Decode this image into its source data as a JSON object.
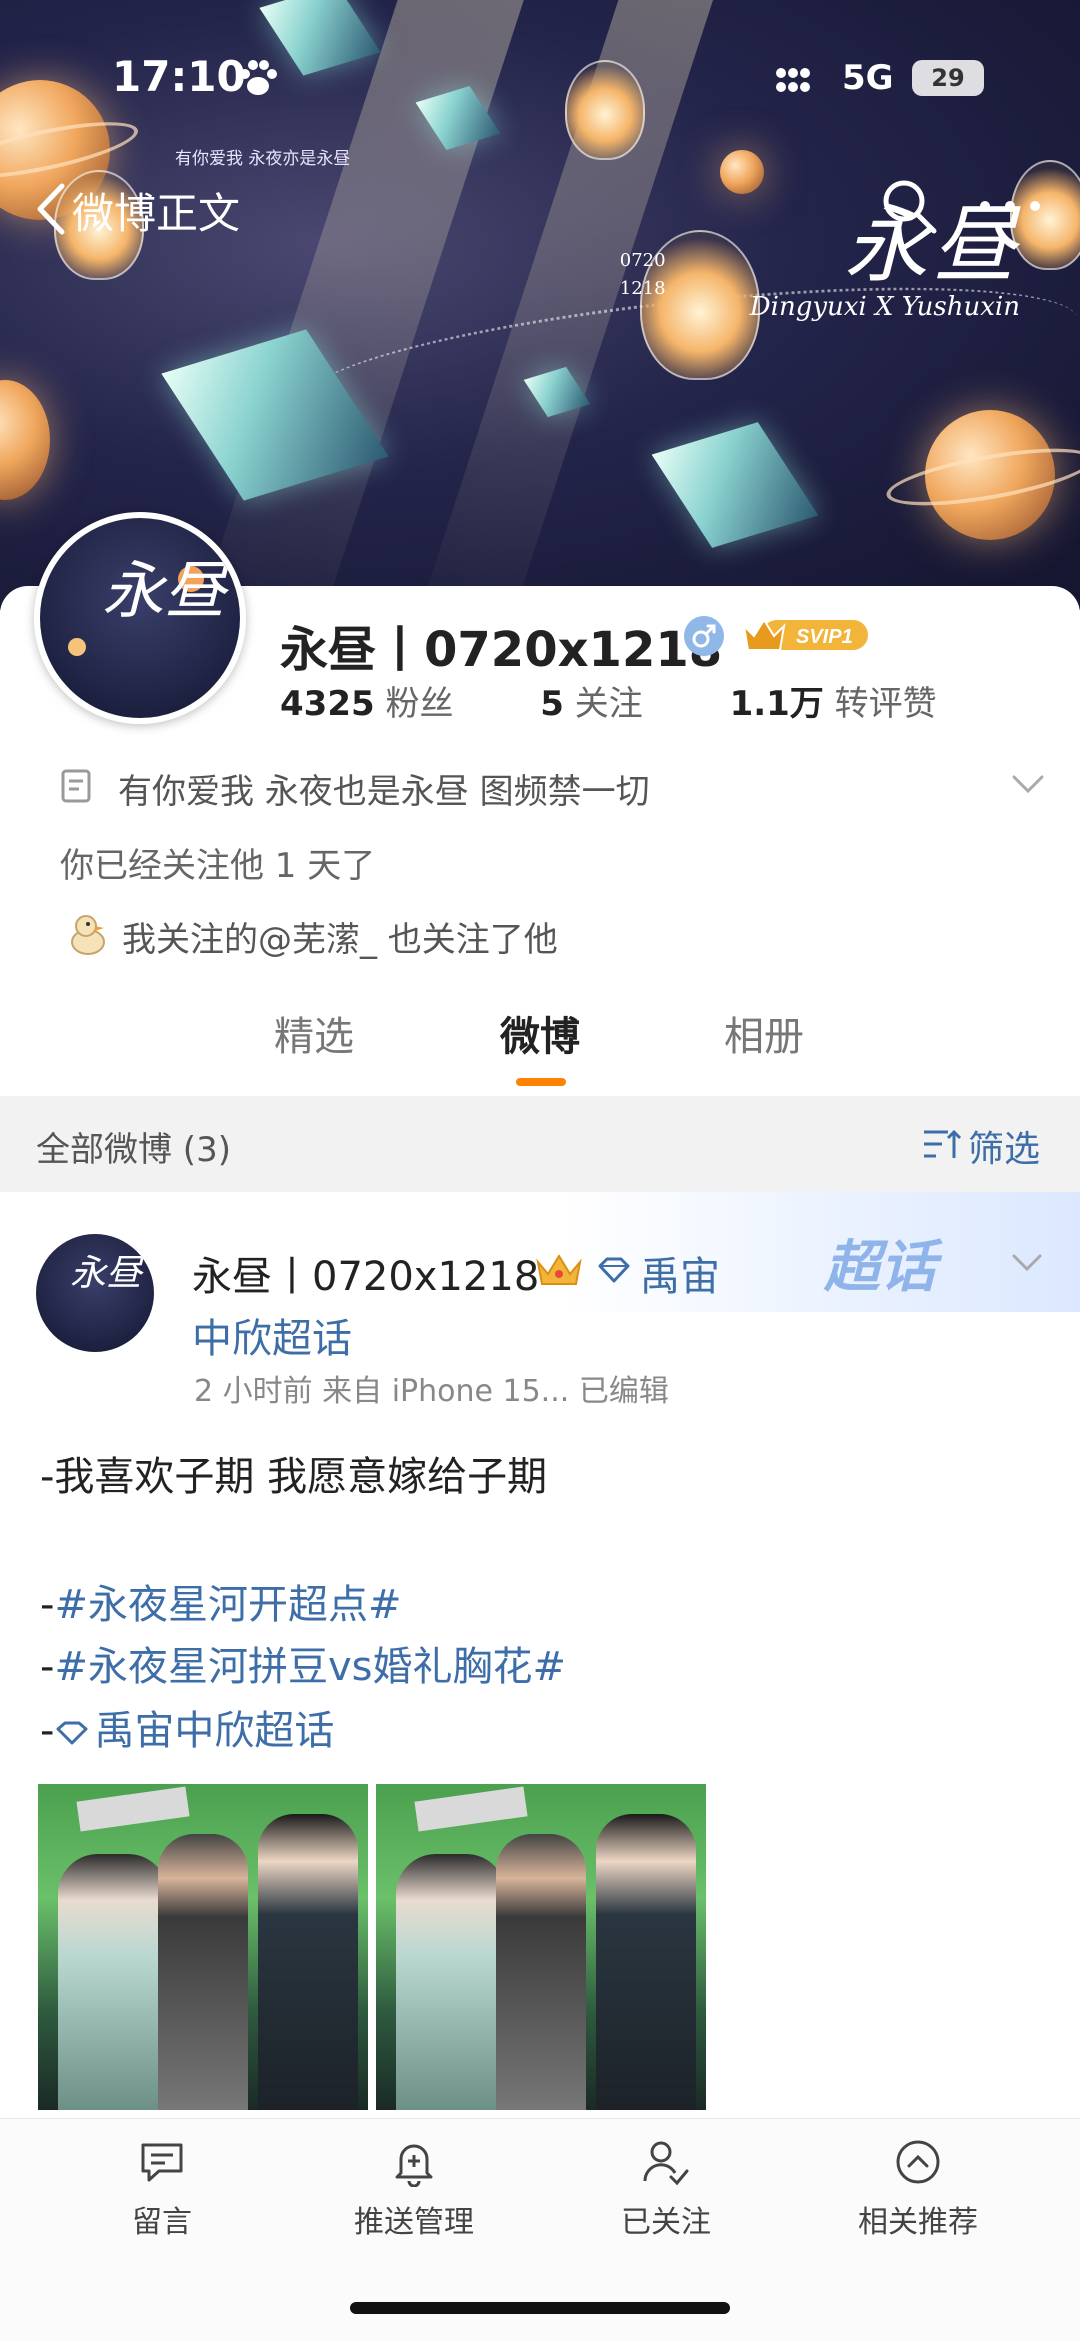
{
  "status_bar": {
    "time": "17:10",
    "network": "5G",
    "battery": "29"
  },
  "nav": {
    "back_label": "微博正文"
  },
  "banner": {
    "tagline": "有你爱我 永夜亦是永昼",
    "title": "永昼",
    "date_a": "0720",
    "date_b": "1218",
    "subtitle": "Dingyuxi X Yushuxin"
  },
  "profile": {
    "name": "永昼丨0720x1218",
    "vip_badge": "SVIP1",
    "fans_count": "4325",
    "fans_label": "粉丝",
    "following_count": "5",
    "following_label": "关注",
    "likes_count": "1.1万",
    "likes_label": "转评赞",
    "bio": "有你爱我 永夜也是永昼 图频禁一切",
    "follow_days": "你已经关注他 1 天了",
    "mutual": "我关注的@芜潆_ 也关注了他"
  },
  "tabs": [
    {
      "label": "精选"
    },
    {
      "label": "微博"
    },
    {
      "label": "相册"
    }
  ],
  "filter": {
    "label": "全部微博 (3)",
    "button": "筛选"
  },
  "post": {
    "badge": "超话",
    "author": "永昼丨0720x1218",
    "topic_line1": "禹宙",
    "topic_line2": "中欣超话",
    "meta": "2 小时前   来自 iPhone 15...   已编辑",
    "line1": "-我喜欢子期 我愿意嫁给子期",
    "dash": "-",
    "tag1": "#永夜星河开超点#",
    "tag2": "#永夜星河拼豆vs婚礼胸花#",
    "tag3": "禹宙中欣超话"
  },
  "bottom_bar": [
    {
      "label": "留言",
      "icon": "comment-icon"
    },
    {
      "label": "推送管理",
      "icon": "bell-plus-icon"
    },
    {
      "label": "已关注",
      "icon": "user-check-icon"
    },
    {
      "label": "相关推荐",
      "icon": "chevron-up-circle-icon"
    }
  ],
  "colors": {
    "accent": "#ff8200",
    "link": "#3d6ea8"
  }
}
